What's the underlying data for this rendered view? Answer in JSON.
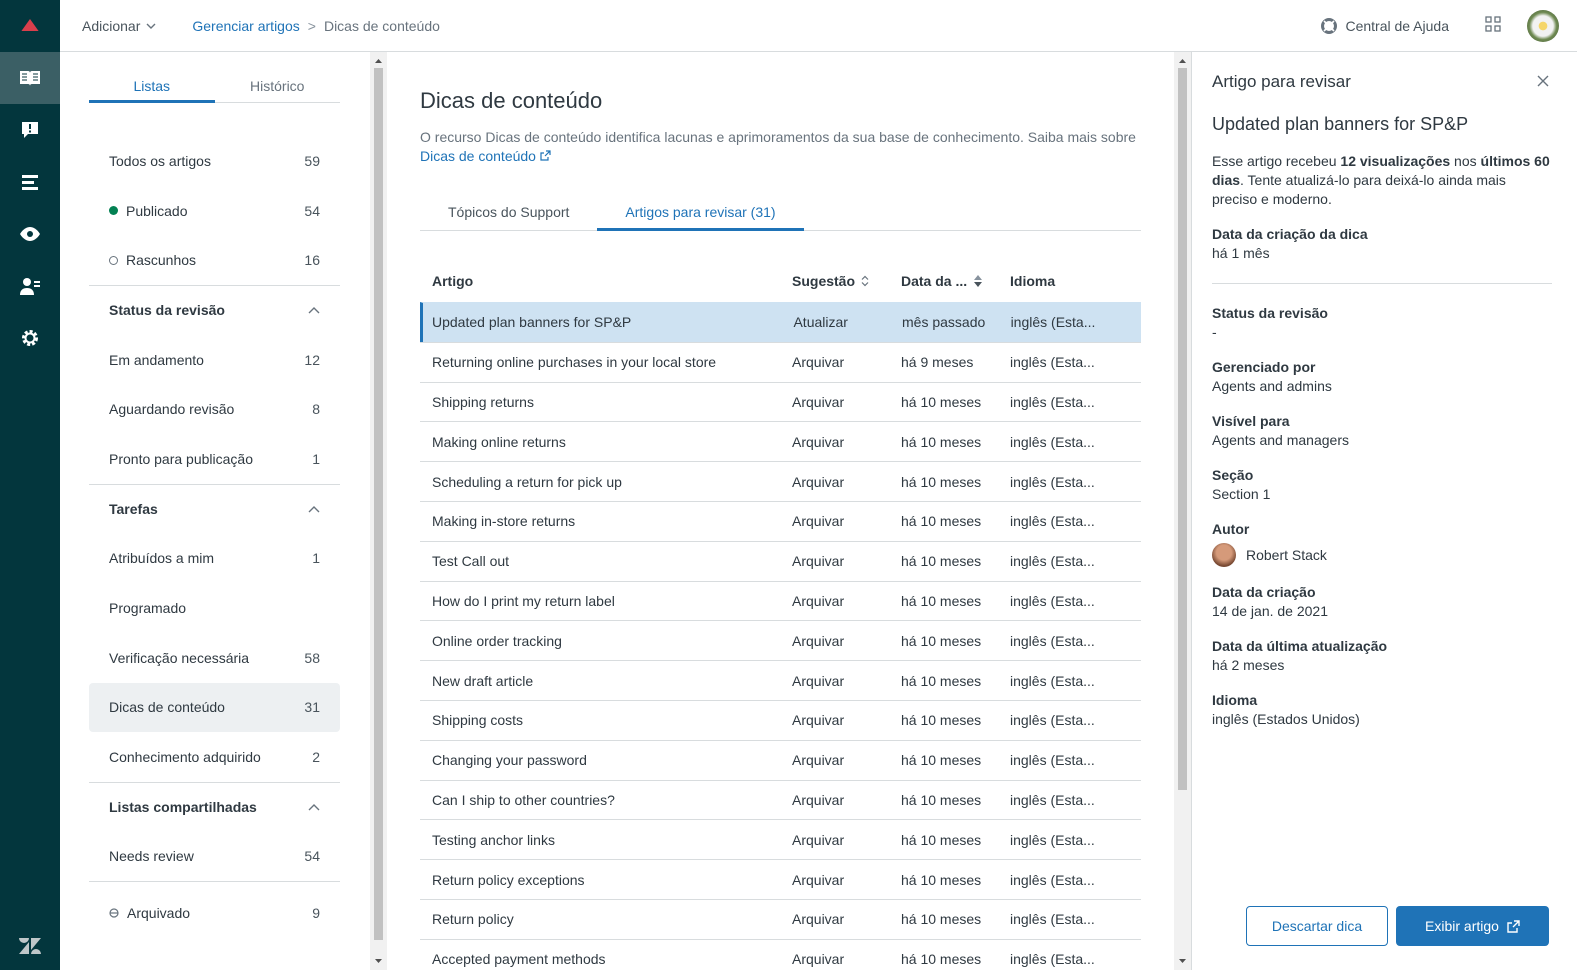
{
  "header": {
    "add_label": "Adicionar",
    "breadcrumb": {
      "link": "Gerenciar artigos",
      "separator": ">",
      "current": "Dicas de conteúdo"
    },
    "help_label": "Central de Ajuda"
  },
  "sidebar": {
    "tabs": [
      {
        "label": "Listas",
        "active": true
      },
      {
        "label": "Histórico",
        "active": false
      }
    ],
    "top_items": [
      {
        "label": "Todos os artigos",
        "count": "59"
      },
      {
        "label": "Publicado",
        "count": "54"
      },
      {
        "label": "Rascunhos",
        "count": "16"
      }
    ],
    "review_section": {
      "title": "Status da revisão",
      "items": [
        {
          "label": "Em andamento",
          "count": "12"
        },
        {
          "label": "Aguardando revisão",
          "count": "8"
        },
        {
          "label": "Pronto para publicação",
          "count": "1"
        }
      ]
    },
    "tasks_section": {
      "title": "Tarefas",
      "items": [
        {
          "label": "Atribuídos a mim",
          "count": "1"
        },
        {
          "label": "Programado",
          "count": ""
        },
        {
          "label": "Verificação necessária",
          "count": "58"
        },
        {
          "label": "Dicas de conteúdo",
          "count": "31"
        },
        {
          "label": "Conhecimento adquirido",
          "count": "2"
        }
      ]
    },
    "shared_section": {
      "title": "Listas compartilhadas",
      "items": [
        {
          "label": "Needs review",
          "count": "54"
        }
      ]
    },
    "archived": {
      "label": "Arquivado",
      "count": "9"
    }
  },
  "main": {
    "title": "Dicas de conteúdo",
    "description": "O recurso Dicas de conteúdo identifica lacunas e aprimoramentos da sua base de conhecimento. Saiba mais sobre",
    "description_link": "Dicas de conteúdo",
    "tabs": [
      {
        "label": "Tópicos do Support",
        "active": false
      },
      {
        "label": "Artigos para revisar (31)",
        "active": true
      }
    ],
    "columns": [
      "Artigo",
      "Sugestão",
      "Data da ...",
      "Idioma"
    ],
    "rows": [
      {
        "article": "Updated plan banners for SP&P",
        "suggestion": "Atualizar",
        "date": "mês passado",
        "language": "inglês (Esta..."
      },
      {
        "article": "Returning online purchases in your local store",
        "suggestion": "Arquivar",
        "date": "há 9 meses",
        "language": "inglês (Esta..."
      },
      {
        "article": "Shipping returns",
        "suggestion": "Arquivar",
        "date": "há 10 meses",
        "language": "inglês (Esta..."
      },
      {
        "article": "Making online returns",
        "suggestion": "Arquivar",
        "date": "há 10 meses",
        "language": "inglês (Esta..."
      },
      {
        "article": "Scheduling a return for pick up",
        "suggestion": "Arquivar",
        "date": "há 10 meses",
        "language": "inglês (Esta..."
      },
      {
        "article": "Making in-store returns",
        "suggestion": "Arquivar",
        "date": "há 10 meses",
        "language": "inglês (Esta..."
      },
      {
        "article": "Test Call out",
        "suggestion": "Arquivar",
        "date": "há 10 meses",
        "language": "inglês (Esta..."
      },
      {
        "article": "How do I print my return label",
        "suggestion": "Arquivar",
        "date": "há 10 meses",
        "language": "inglês (Esta..."
      },
      {
        "article": "Online order tracking",
        "suggestion": "Arquivar",
        "date": "há 10 meses",
        "language": "inglês (Esta..."
      },
      {
        "article": "New draft article",
        "suggestion": "Arquivar",
        "date": "há 10 meses",
        "language": "inglês (Esta..."
      },
      {
        "article": "Shipping costs",
        "suggestion": "Arquivar",
        "date": "há 10 meses",
        "language": "inglês (Esta..."
      },
      {
        "article": "Changing your password",
        "suggestion": "Arquivar",
        "date": "há 10 meses",
        "language": "inglês (Esta..."
      },
      {
        "article": "Can I ship to other countries?",
        "suggestion": "Arquivar",
        "date": "há 10 meses",
        "language": "inglês (Esta..."
      },
      {
        "article": "Testing anchor links",
        "suggestion": "Arquivar",
        "date": "há 10 meses",
        "language": "inglês (Esta..."
      },
      {
        "article": "Return policy exceptions",
        "suggestion": "Arquivar",
        "date": "há 10 meses",
        "language": "inglês (Esta..."
      },
      {
        "article": "Return policy",
        "suggestion": "Arquivar",
        "date": "há 10 meses",
        "language": "inglês (Esta..."
      },
      {
        "article": "Accepted payment methods",
        "suggestion": "Arquivar",
        "date": "há 10 meses",
        "language": "inglês (Esta..."
      }
    ]
  },
  "panel": {
    "heading": "Artigo para revisar",
    "title": "Updated plan banners for SP&P",
    "summary": {
      "p1": "Esse artigo recebeu ",
      "b1": "12 visualizações",
      "p2": " nos ",
      "b2": "últimos 60 dias",
      "p3": ". Tente atualizá-lo para deixá-lo ainda mais preciso e moderno."
    },
    "tip_created": {
      "label": "Data da criação da dica",
      "value": "há 1 mês"
    },
    "fields": [
      {
        "label": "Status da revisão",
        "value": "-"
      },
      {
        "label": "Gerenciado por",
        "value": "Agents and admins"
      },
      {
        "label": "Visível para",
        "value": "Agents and managers"
      },
      {
        "label": "Seção",
        "value": "Section 1"
      }
    ],
    "author": {
      "label": "Autor",
      "name": "Robert Stack"
    },
    "fields2": [
      {
        "label": "Data da criação",
        "value": "14 de jan. de 2021"
      },
      {
        "label": "Data da última atualização",
        "value": "há 2 meses"
      },
      {
        "label": "Idioma",
        "value": "inglês (Estados Unidos)"
      }
    ],
    "dismiss_label": "Descartar dica",
    "view_label": "Exibir artigo"
  },
  "colors": {
    "rail": "#03363d",
    "accent": "#1f73b7",
    "selected_row": "#cee2f2",
    "published": "#038153"
  }
}
